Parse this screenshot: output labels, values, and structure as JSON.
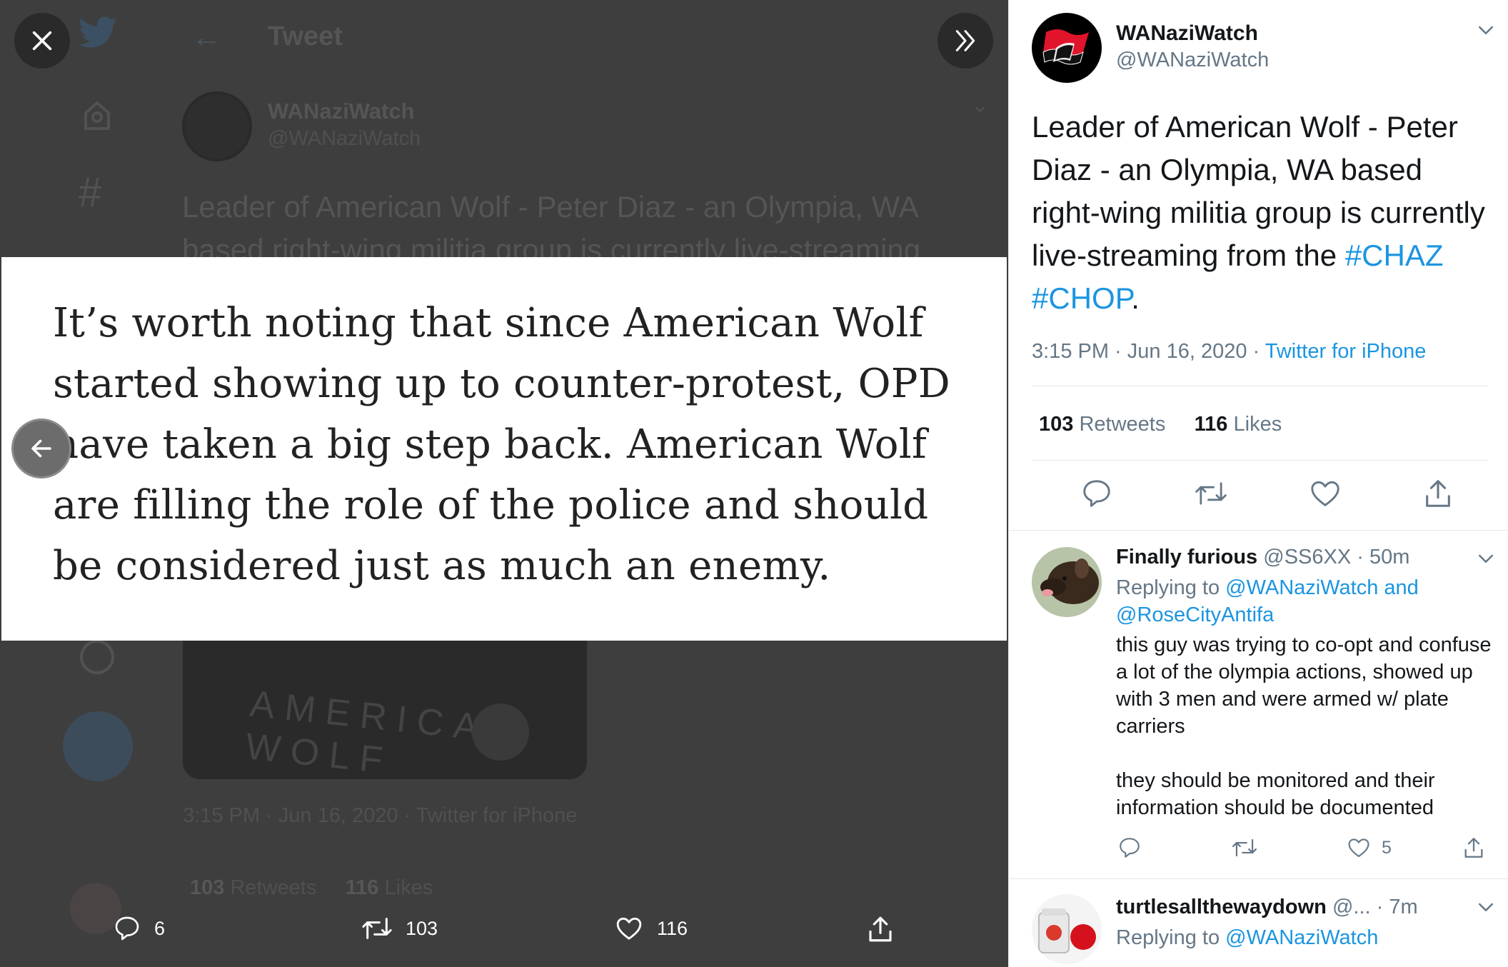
{
  "background_page": {
    "header_title": "Tweet",
    "tweet": {
      "name": "WANaziWatch",
      "handle": "@WANaziWatch",
      "text": "Leader of American Wolf - Peter Diaz -  an Olympia, WA based right-wing militia group is currently live-streaming",
      "media_label": "AMERICAN WOLF",
      "timestamp": "3:15 PM · Jun 16, 2020 · Twitter for iPhone",
      "retweets_count": "103",
      "retweets_label": "Retweets",
      "likes_count": "116",
      "likes_label": "Likes"
    }
  },
  "viewer": {
    "quote_text": "It’s worth noting that since American Wolf started showing up to counter-protest, OPD have taken a big step back. American Wolf are filling the role of the police and should be considered just as much an enemy.",
    "actions": {
      "reply_count": "6",
      "retweet_count": "103",
      "like_count": "116"
    }
  },
  "sidebar": {
    "tweet": {
      "name": "WANaziWatch",
      "handle": "@WANaziWatch",
      "text_before": "Leader of American Wolf - Peter Diaz -  an Olympia, WA based right-wing militia group is currently live-streaming from the ",
      "hashtag1": "#CHAZ",
      "hashtag2": "#CHOP",
      "text_after": ".",
      "time": "3:15 PM · Jun 16, 2020 · ",
      "source": "Twitter for iPhone",
      "retweets_count": "103",
      "retweets_label": "Retweets",
      "likes_count": "116",
      "likes_label": "Likes"
    },
    "replies": [
      {
        "name": "Finally furious",
        "handle": "@SS6XX",
        "age": "· 50m",
        "replying_prefix": "Replying to ",
        "replying_to": "@WANaziWatch and @RoseCityAntifa",
        "text": "this guy was trying to co-opt and confuse a lot of the olympia actions, showed up with 3 men and were armed w/ plate carriers\n\nthey should be monitored and their information should be documented",
        "like_count": "5"
      },
      {
        "name": "turtlesallthewaydown",
        "handle": "@...",
        "age": "· 7m",
        "replying_prefix": "Replying to ",
        "replying_to": "@WANaziWatch"
      }
    ]
  },
  "colors": {
    "link": "#1b95e0",
    "dim_overlay": "#3e3e3e",
    "text_dark": "#14171a",
    "text_gray": "#657786"
  },
  "icons": [
    "close-icon",
    "expand-icon",
    "twitter-bird-icon",
    "home-icon",
    "hashtag-icon",
    "more-icon",
    "compose-icon",
    "back-arrow-icon",
    "prev-arrow-icon",
    "reply-icon",
    "retweet-icon",
    "like-icon",
    "share-icon",
    "chevron-down-icon",
    "antifa-flag-icon"
  ]
}
